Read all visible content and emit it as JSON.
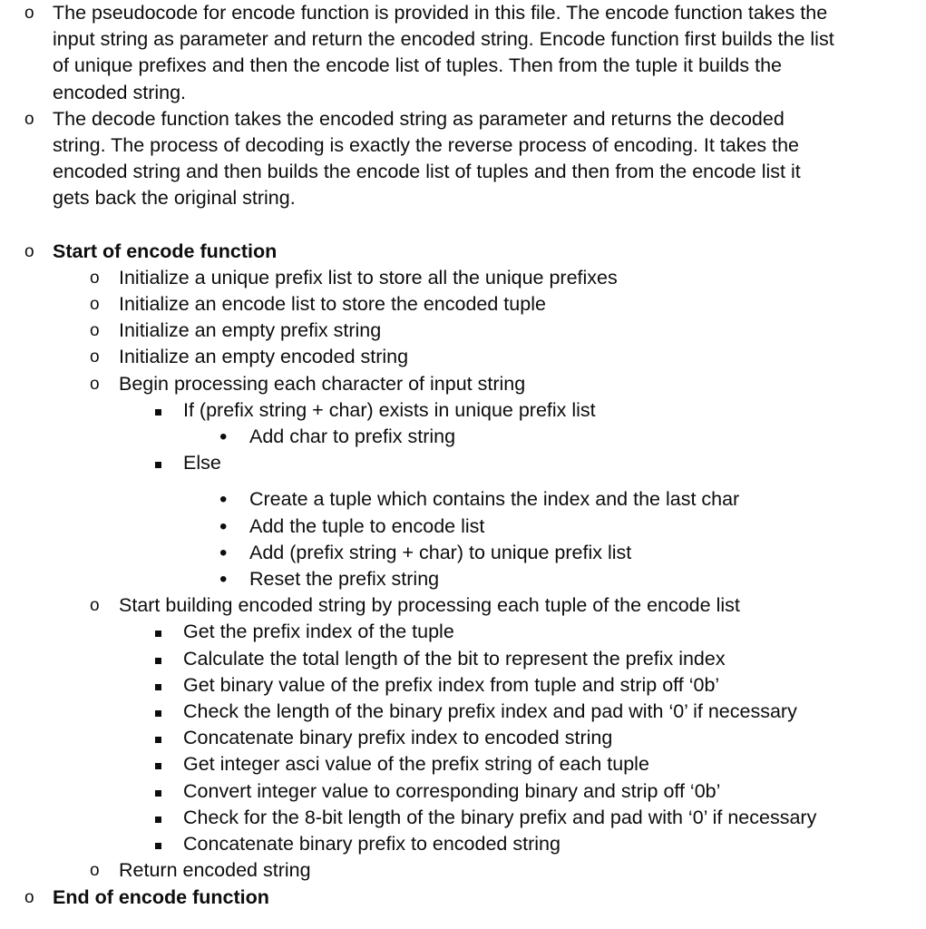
{
  "document": {
    "bullet_glyphs": {
      "level1": "o",
      "level2": "o",
      "level3": "square",
      "level4": "•"
    },
    "colors": {
      "text": "#0d0d0d",
      "background": "#ffffff"
    },
    "items": [
      {
        "id": "intro-encode",
        "level": 1,
        "bold": false,
        "text": "The pseudocode for encode function is provided in this file. The encode function takes the input string as parameter and return the encoded string. Encode function first builds the list of unique prefixes and then the encode list of tuples. Then from the tuple it builds the encoded string."
      },
      {
        "id": "intro-decode",
        "level": 1,
        "bold": false,
        "text": "The decode function takes the encoded string as parameter and returns the decoded string. The process of decoding is exactly the reverse process of encoding.  It takes the encoded string and then builds the encode list of tuples and then from the encode list it gets back the original string."
      },
      {
        "id": "start-of-encode-function",
        "level": 1,
        "bold": true,
        "spacing": "gap-before",
        "text": "Start of encode function"
      },
      {
        "id": "init-unique-prefix-list",
        "level": 2,
        "bold": false,
        "text": "Initialize a unique prefix list to store all the unique prefixes"
      },
      {
        "id": "init-encode-list",
        "level": 2,
        "bold": false,
        "text": "Initialize an encode list to store the encoded tuple"
      },
      {
        "id": "init-empty-prefix-string",
        "level": 2,
        "bold": false,
        "text": "Initialize an empty prefix string"
      },
      {
        "id": "init-empty-encoded-string",
        "level": 2,
        "bold": false,
        "text": "Initialize an empty encoded string"
      },
      {
        "id": "begin-processing-characters",
        "level": 2,
        "bold": false,
        "text": "Begin processing each character of input string"
      },
      {
        "id": "if-prefix-exists",
        "level": 3,
        "bold": false,
        "text": "If (prefix string + char) exists in unique prefix list"
      },
      {
        "id": "add-char-to-prefix-string",
        "level": 4,
        "bold": false,
        "text": "Add char to prefix string"
      },
      {
        "id": "else",
        "level": 3,
        "bold": false,
        "text": "Else"
      },
      {
        "id": "create-tuple",
        "level": 4,
        "bold": false,
        "spacing": "gap-small-before",
        "text": "Create a tuple which contains the index and the last char"
      },
      {
        "id": "add-tuple-to-encode-list",
        "level": 4,
        "bold": false,
        "text": "Add the tuple to encode list"
      },
      {
        "id": "add-prefix-char-to-unique-list",
        "level": 4,
        "bold": false,
        "text": "Add (prefix string + char) to unique prefix list"
      },
      {
        "id": "reset-prefix-string",
        "level": 4,
        "bold": false,
        "text": "Reset the prefix string"
      },
      {
        "id": "start-building-encoded-string",
        "level": 2,
        "bold": false,
        "text": "Start building encoded string by processing each tuple of the encode list"
      },
      {
        "id": "get-prefix-index",
        "level": 3,
        "bold": false,
        "text": "Get the prefix index of the tuple"
      },
      {
        "id": "calculate-total-bit-length",
        "level": 3,
        "bold": false,
        "text": "Calculate the total length of the bit to represent the prefix index"
      },
      {
        "id": "get-binary-value-prefix-index",
        "level": 3,
        "bold": false,
        "text": "Get binary value of the prefix index from tuple and strip off ‘0b’"
      },
      {
        "id": "check-length-binary-prefix-index",
        "level": 3,
        "bold": false,
        "text": "Check the length of the binary prefix index and pad with ‘0’ if necessary"
      },
      {
        "id": "concat-binary-prefix-index",
        "level": 3,
        "bold": false,
        "text": "Concatenate binary prefix index to encoded string"
      },
      {
        "id": "get-integer-asci-value",
        "level": 3,
        "bold": false,
        "text": "Get integer asci value of the prefix string of each tuple"
      },
      {
        "id": "convert-integer-to-binary",
        "level": 3,
        "bold": false,
        "text": "Convert integer value to corresponding binary and strip off ‘0b’"
      },
      {
        "id": "check-8-bit-length",
        "level": 3,
        "bold": false,
        "text": "Check for the 8-bit length of the binary prefix and pad with ‘0’ if necessary"
      },
      {
        "id": "concat-binary-prefix",
        "level": 3,
        "bold": false,
        "text": "Concatenate binary prefix to encoded string"
      },
      {
        "id": "return-encoded-string",
        "level": 2,
        "bold": false,
        "text": "Return encoded string"
      },
      {
        "id": "end-of-encode-function",
        "level": 1,
        "bold": true,
        "text": "End of encode function"
      }
    ]
  }
}
